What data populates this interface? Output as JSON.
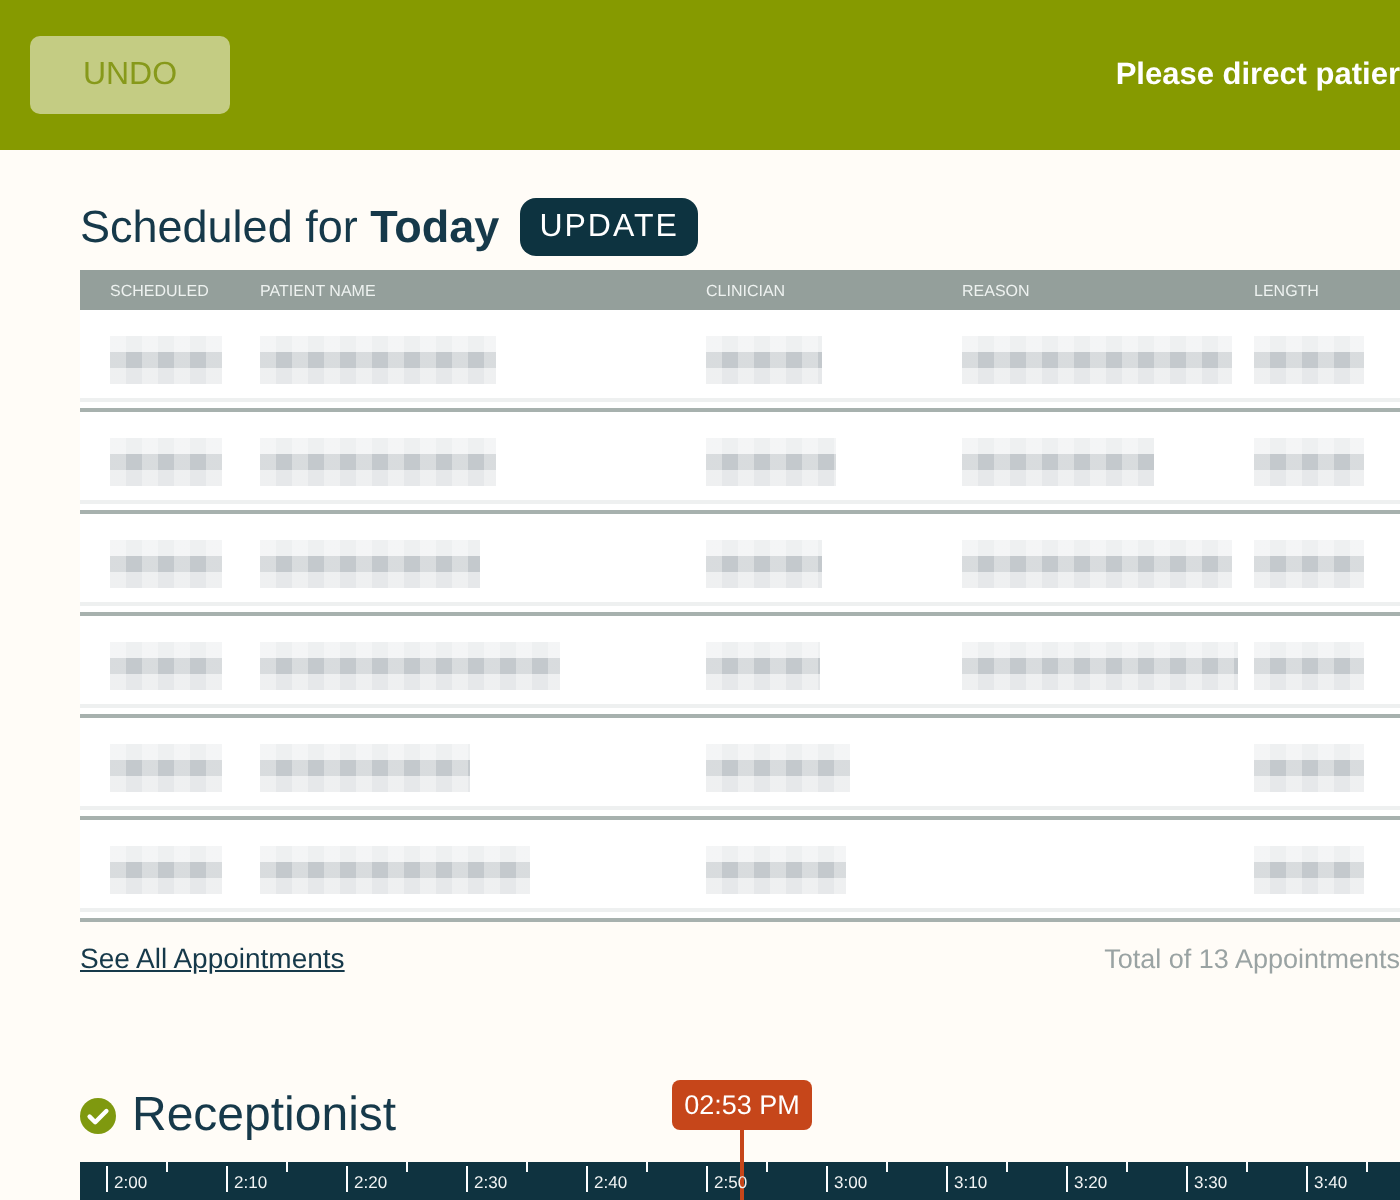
{
  "top_bar": {
    "undo_button": {
      "label": "UNDO",
      "disabled": true
    },
    "message": "Please direct patier"
  },
  "schedule": {
    "title": "Scheduled for **Today**",
    "update_button": "UPDATE",
    "columns": [
      "SCHEDULED",
      "PATIENT NAME",
      "CLINICIAN",
      "REASON",
      "LENGTH"
    ],
    "rows": [
      {
        "cells": [
          {
            "kind": "pixelated"
          },
          {
            "kind": "pixelated"
          },
          {
            "kind": "pixelated"
          },
          {
            "kind": "pixelated"
          },
          {
            "kind": "pixelated"
          }
        ]
      },
      {
        "cells": [
          {
            "kind": "pixelated"
          },
          {
            "kind": "pixelated"
          },
          {
            "kind": "pixelated"
          },
          {
            "kind": "pixelated"
          },
          {
            "kind": "pixelated"
          }
        ]
      },
      {
        "cells": [
          {
            "kind": "pixelated"
          },
          {
            "kind": "pixelated"
          },
          {
            "kind": "pixelated"
          },
          {
            "kind": "pixelated"
          },
          {
            "kind": "pixelated"
          }
        ]
      },
      {
        "cells": [
          {
            "kind": "pixelated"
          },
          {
            "kind": "pixelated"
          },
          {
            "kind": "pixelated"
          },
          {
            "kind": "pixelated"
          },
          {
            "kind": "pixelated"
          }
        ]
      },
      {
        "cells": [
          {
            "kind": "pixelated"
          },
          {
            "kind": "pixelated"
          },
          {
            "kind": "pixelated"
          },
          {
            "kind": "blank"
          },
          {
            "kind": "pixelated"
          }
        ]
      },
      {
        "cells": [
          {
            "kind": "pixelated"
          },
          {
            "kind": "pixelated"
          },
          {
            "kind": "pixelated"
          },
          {
            "kind": "blank"
          },
          {
            "kind": "pixelated"
          }
        ]
      }
    ],
    "link": "See All Appointments",
    "total": "Total of 13 Appointments"
  },
  "receptionist": {
    "title": "Receptionist",
    "time_marker": "02:53 PM",
    "timeline_ticks": [
      "2:00",
      "2:10",
      "2:20",
      "2:30",
      "2:40",
      "2:50",
      "3:00",
      "3:10",
      "3:20",
      "3:30",
      "3:40"
    ]
  }
}
